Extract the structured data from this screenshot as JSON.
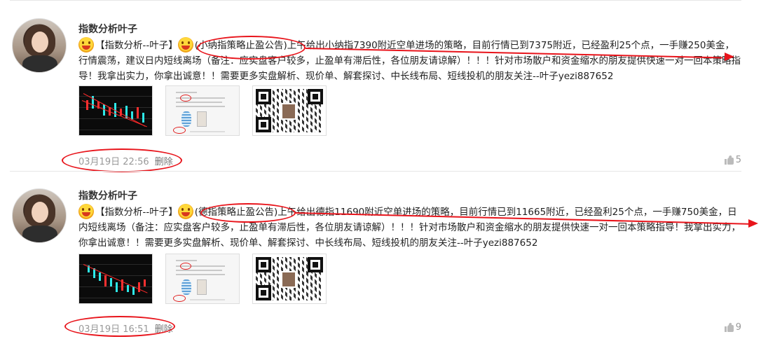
{
  "posts": [
    {
      "author": "指数分析叶子",
      "tag": "【指数分析--叶子】",
      "strategy": "(小纳指策略止盈公告)",
      "body": "上午给出小纳指7390附近空单进场的策略，目前行情已到7375附近，已经盈利25个点，一手赚250美金，行情震荡，建议日内短线离场（备注：应实盘客户较多，止盈单有滞后性，各位朋友请谅解）！！！针对市场散户和资金缩水的朋友提供快速一对一回本策略指导！我拿出实力，你拿出诚意！！需要更多实盘解析、现价单、解套探讨、中长线布局、短线投机的朋友关注--叶子yezi887652",
      "time": "03月19日 22:56",
      "delete_label": "删除",
      "likes": "5"
    },
    {
      "author": "指数分析叶子",
      "tag": "【指数分析--叶子】",
      "strategy": "(德指策略止盈公告)",
      "body": "上午给出德指11690附近空单进场的策略，目前行情已到11665附近，已经盈利25个点，一手赚750美金，日内短线离场（备注：应实盘客户较多，止盈单有滞后性，各位朋友请谅解）！！！针对市场散户和资金缩水的朋友提供快速一对一回本策略指导！我拿出实力，你拿出诚意！！需要更多实盘解析、现价单、解套探讨、中长线布局、短线投机的朋友关注--叶子yezi887652",
      "time": "03月19日 16:51",
      "delete_label": "删除",
      "likes": "9"
    }
  ],
  "icons": {
    "avatar": "avatar-photo",
    "emoji": "grinning-emoji-icon",
    "like": "thumbs-up-icon"
  },
  "colors": {
    "annotation": "#e8141b",
    "meta_text": "#999999",
    "body_text": "#222222"
  }
}
